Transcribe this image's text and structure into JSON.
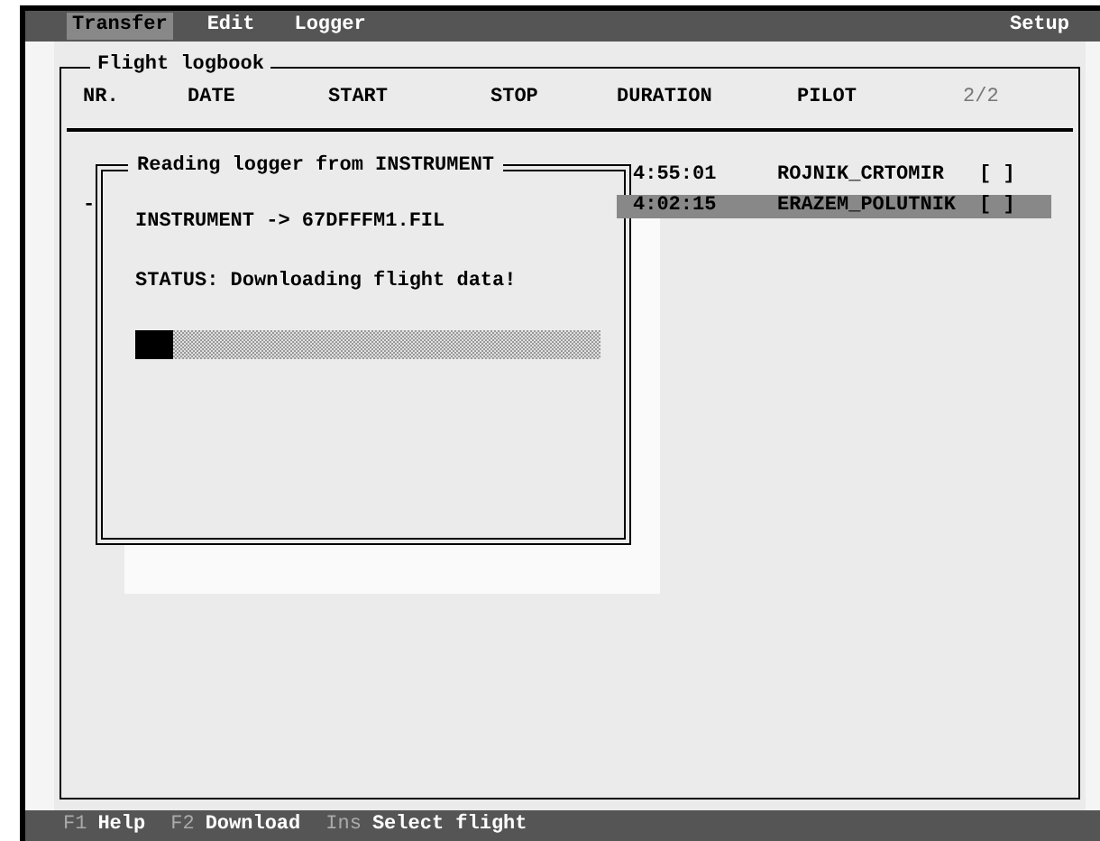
{
  "menu": [
    {
      "label": "Transfer",
      "selected": true
    },
    {
      "label": "Edit",
      "selected": false
    },
    {
      "label": "Logger",
      "selected": false
    }
  ],
  "menu_right": {
    "label": "Setup",
    "selected": false
  },
  "logbook": {
    "title": "Flight logbook",
    "columns": [
      "NR.",
      "DATE",
      "START",
      "STOP",
      "DURATION",
      "PILOT"
    ],
    "page": "2/2",
    "rows": [
      {
        "column_1": "",
        "duration": "4:55:01",
        "pilot": "ROJNIK_CRTOMIR",
        "mark": "[ ]",
        "selected": false
      },
      {
        "column_1": "-",
        "duration": "4:02:15",
        "pilot": "ERAZEM_POLUTNIK",
        "mark": "[ ]",
        "selected": true
      }
    ]
  },
  "dialog": {
    "title": "Reading logger from INSTRUMENT",
    "file_line": "INSTRUMENT -> 67DFFFM1.FIL",
    "status": "STATUS: Downloading flight data!",
    "level": 0.08
  },
  "status_bar": [
    {
      "key": "F1",
      "label": "Help"
    },
    {
      "key": "F2",
      "label": "Download"
    },
    {
      "key": "Ins",
      "label": "Select flight"
    }
  ]
}
